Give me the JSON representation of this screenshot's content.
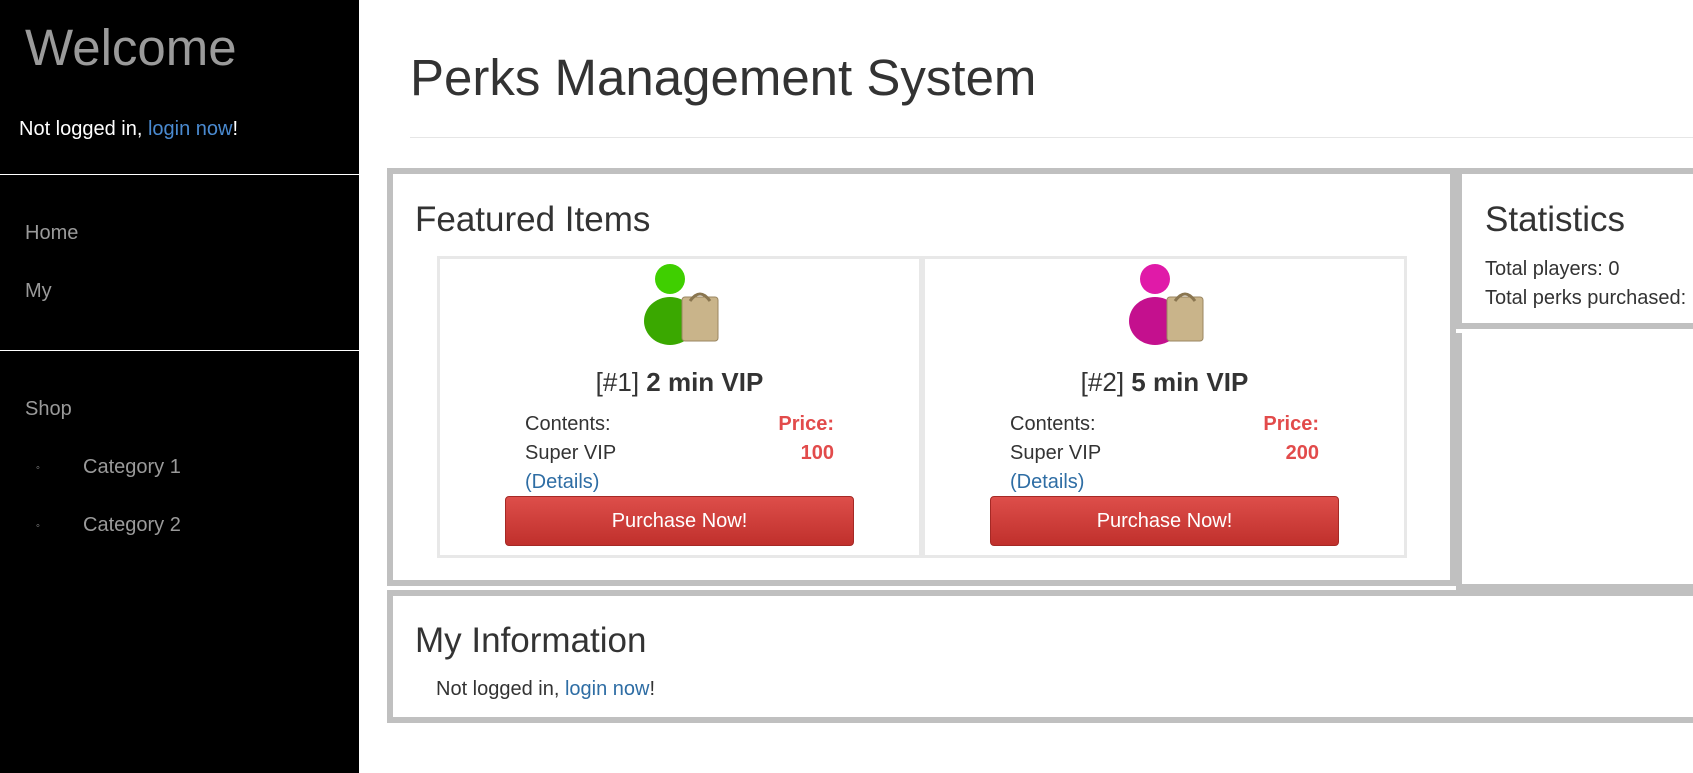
{
  "sidebar": {
    "welcome": "Welcome",
    "login_prefix": "Not logged in, ",
    "login_link": "login now",
    "login_suffix": "!",
    "nav": {
      "home": "Home",
      "my": "My",
      "shop": "Shop"
    },
    "categories": [
      "Category 1",
      "Category 2"
    ],
    "bullet": "◦"
  },
  "main": {
    "title": "Perks Management System",
    "featured": {
      "heading": "Featured Items",
      "items": [
        {
          "number": "[#1]",
          "name": "2 min VIP",
          "contents_label": "Contents:",
          "contents": "Super VIP",
          "details": "(Details)",
          "price_label": "Price:",
          "price": "100",
          "button": "Purchase Now!",
          "icon": "user-shopping-bag-icon",
          "icon_color": "#3fcf00"
        },
        {
          "number": "[#2]",
          "name": "5 min VIP",
          "contents_label": "Contents:",
          "contents": "Super VIP",
          "details": "(Details)",
          "price_label": "Price:",
          "price": "200",
          "button": "Purchase Now!",
          "icon": "user-shopping-bag-icon",
          "icon_color": "#e01aa8"
        }
      ]
    },
    "statistics": {
      "heading": "Statistics",
      "total_players": "Total players: 0",
      "total_perks": "Total perks purchased:"
    },
    "my_information": {
      "heading": "My Information",
      "prefix": "Not logged in, ",
      "link": "login now",
      "suffix": "!"
    }
  },
  "colors": {
    "price": "#e24b4b",
    "button": "#c9342f",
    "link": "#2e6da4",
    "panel_border": "#c0c0c0"
  }
}
